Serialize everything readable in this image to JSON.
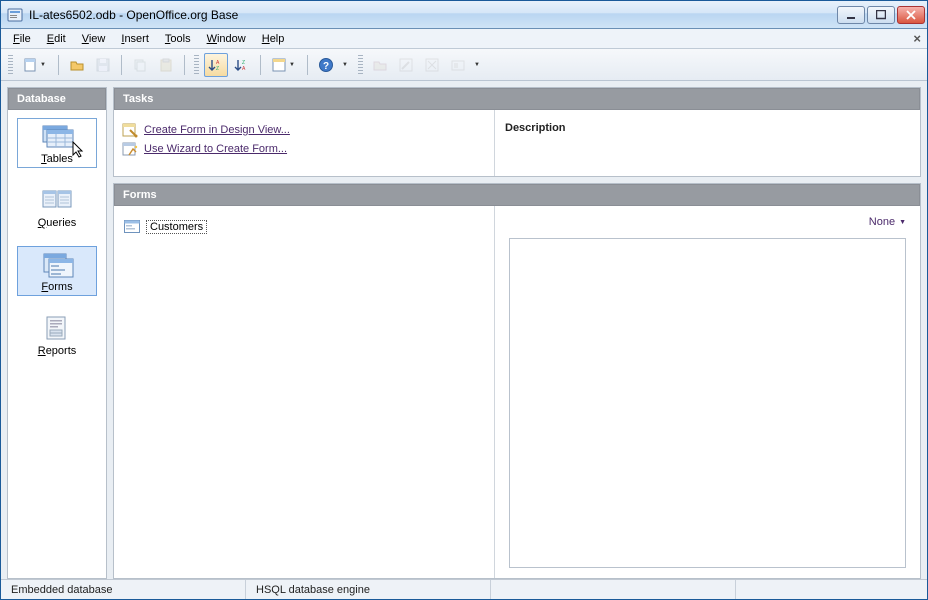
{
  "window": {
    "title": "IL-ates6502.odb - OpenOffice.org Base"
  },
  "menu": {
    "file": "File",
    "edit": "Edit",
    "view": "View",
    "insert": "Insert",
    "tools": "Tools",
    "window": "Window",
    "help": "Help"
  },
  "sidebar": {
    "header": "Database",
    "items": [
      {
        "label": "Tables"
      },
      {
        "label": "Queries"
      },
      {
        "label": "Forms"
      },
      {
        "label": "Reports"
      }
    ]
  },
  "tasks": {
    "header": "Tasks",
    "items": [
      {
        "label": "Create Form in Design View..."
      },
      {
        "label": "Use Wizard to Create Form..."
      }
    ],
    "description_label": "Description"
  },
  "forms_section": {
    "header": "Forms",
    "entries": [
      {
        "name": "Customers"
      }
    ],
    "view_mode": "None"
  },
  "status": {
    "left": "Embedded database",
    "engine": "HSQL database engine"
  }
}
